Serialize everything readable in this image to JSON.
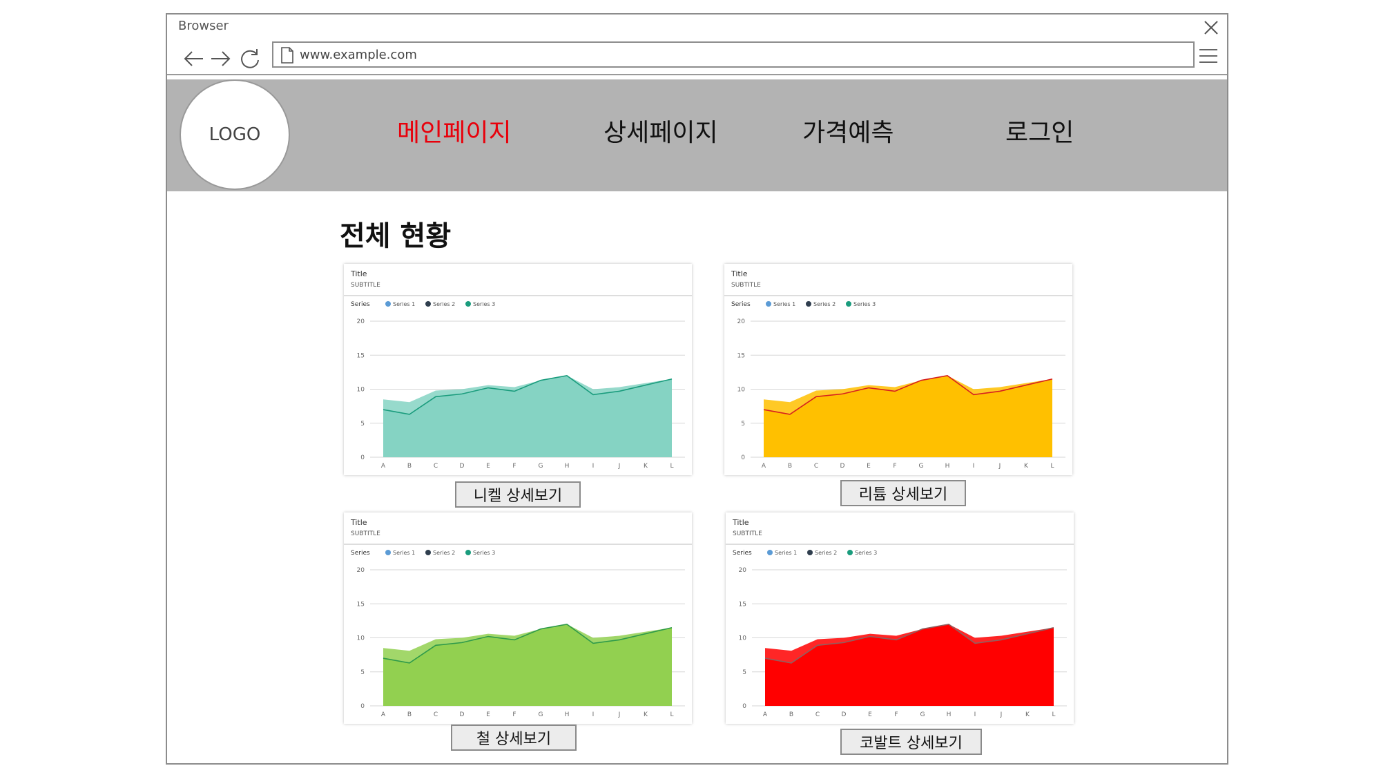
{
  "browser": {
    "title": "Browser",
    "url": "www.example.com"
  },
  "header": {
    "logo": "LOGO",
    "nav": [
      "메인페이지",
      "상세페이지",
      "가격예측",
      "로그인"
    ],
    "active_color": "#e8000b"
  },
  "main": {
    "section_title": "전체 현황"
  },
  "cards": [
    {
      "title": "Title",
      "subtitle": "SUBTITLE",
      "legend_label": "Series",
      "button": "니켈 상세보기",
      "color": "#85d3c3",
      "line": "#1a9c7d"
    },
    {
      "title": "Title",
      "subtitle": "SUBTITLE",
      "legend_label": "Series",
      "button": "리튬 상세보기",
      "color": "#ffc000",
      "line": "#d61f1f"
    },
    {
      "title": "Title",
      "subtitle": "SUBTITLE",
      "legend_label": "Series",
      "button": "철 상세보기",
      "color": "#92d050",
      "line": "#2e9a4a"
    },
    {
      "title": "Title",
      "subtitle": "SUBTITLE",
      "legend_label": "Series",
      "button": "코발트 상세보기",
      "color": "#ff0000",
      "line": "#8f6060"
    }
  ],
  "chart_data": [
    {
      "type": "area",
      "categories": [
        "A",
        "B",
        "C",
        "D",
        "E",
        "F",
        "G",
        "H",
        "I",
        "J",
        "K",
        "L"
      ],
      "ylim": [
        0,
        20
      ],
      "yticks": [
        0,
        5,
        10,
        15,
        20
      ],
      "legend": [
        "Series 1",
        "Series 2",
        "Series 3"
      ],
      "legend_colors": [
        "#5b9bd5",
        "#2f3e4e",
        "#1a9c7d"
      ],
      "series": [
        {
          "name": "Series 1",
          "values": [
            8.5,
            8.1,
            9.8,
            10.0,
            10.6,
            10.3,
            11.3,
            12.0,
            10.0,
            10.3,
            10.9,
            11.5
          ]
        },
        {
          "name": "Series 2",
          "values": [
            7.0,
            6.3,
            8.9,
            9.3,
            10.2,
            9.7,
            11.3,
            12.0,
            9.2,
            9.7,
            10.6,
            11.5
          ]
        }
      ]
    },
    {
      "type": "area",
      "categories": [
        "A",
        "B",
        "C",
        "D",
        "E",
        "F",
        "G",
        "H",
        "I",
        "J",
        "K",
        "L"
      ],
      "ylim": [
        0,
        20
      ],
      "yticks": [
        0,
        5,
        10,
        15,
        20
      ],
      "legend": [
        "Series 1",
        "Series 2",
        "Series 3"
      ],
      "legend_colors": [
        "#5b9bd5",
        "#2f3e4e",
        "#1a9c7d"
      ],
      "series": [
        {
          "name": "Series 1",
          "values": [
            8.5,
            8.1,
            9.8,
            10.0,
            10.6,
            10.3,
            11.3,
            12.0,
            10.0,
            10.3,
            10.9,
            11.5
          ]
        },
        {
          "name": "Series 2",
          "values": [
            7.0,
            6.3,
            8.9,
            9.3,
            10.2,
            9.7,
            11.3,
            12.0,
            9.2,
            9.7,
            10.6,
            11.5
          ]
        }
      ]
    },
    {
      "type": "area",
      "categories": [
        "A",
        "B",
        "C",
        "D",
        "E",
        "F",
        "G",
        "H",
        "I",
        "J",
        "K",
        "L"
      ],
      "ylim": [
        0,
        20
      ],
      "yticks": [
        0,
        5,
        10,
        15,
        20
      ],
      "legend": [
        "Series 1",
        "Series 2",
        "Series 3"
      ],
      "legend_colors": [
        "#5b9bd5",
        "#2f3e4e",
        "#1a9c7d"
      ],
      "series": [
        {
          "name": "Series 1",
          "values": [
            8.5,
            8.1,
            9.8,
            10.0,
            10.6,
            10.3,
            11.3,
            12.0,
            10.0,
            10.3,
            10.9,
            11.5
          ]
        },
        {
          "name": "Series 2",
          "values": [
            7.0,
            6.3,
            8.9,
            9.3,
            10.2,
            9.7,
            11.3,
            12.0,
            9.2,
            9.7,
            10.6,
            11.5
          ]
        }
      ]
    },
    {
      "type": "area",
      "categories": [
        "A",
        "B",
        "C",
        "D",
        "E",
        "F",
        "G",
        "H",
        "I",
        "J",
        "K",
        "L"
      ],
      "ylim": [
        0,
        20
      ],
      "yticks": [
        0,
        5,
        10,
        15,
        20
      ],
      "legend": [
        "Series 1",
        "Series 2",
        "Series 3"
      ],
      "legend_colors": [
        "#5b9bd5",
        "#2f3e4e",
        "#1a9c7d"
      ],
      "series": [
        {
          "name": "Series 1",
          "values": [
            8.5,
            8.1,
            9.8,
            10.0,
            10.6,
            10.3,
            11.3,
            12.0,
            10.0,
            10.3,
            10.9,
            11.5
          ]
        },
        {
          "name": "Series 2",
          "values": [
            7.0,
            6.3,
            8.9,
            9.3,
            10.2,
            9.7,
            11.3,
            12.0,
            9.2,
            9.7,
            10.6,
            11.5
          ]
        }
      ]
    }
  ]
}
